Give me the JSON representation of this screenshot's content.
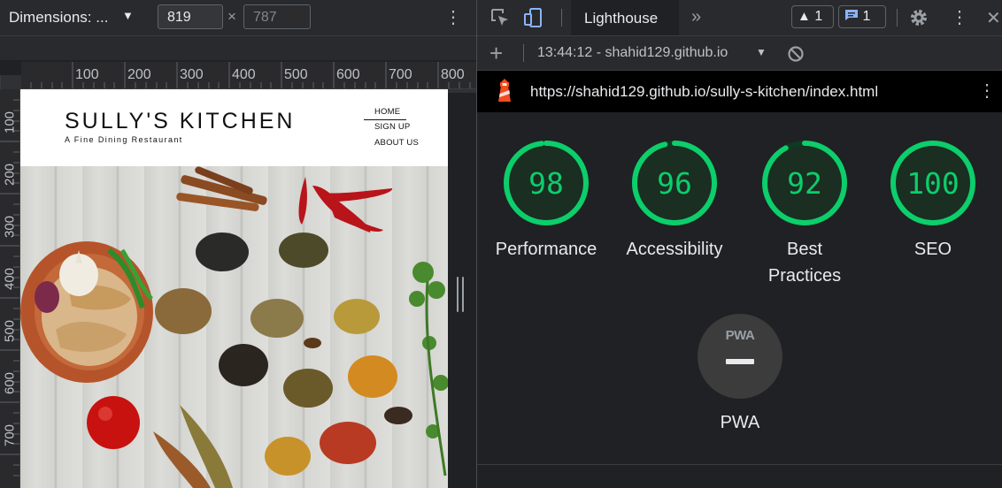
{
  "device_toolbar": {
    "dimensions_label": "Dimensions: ...",
    "caret": "▼",
    "width_value": "819",
    "times": "×",
    "height_placeholder": "787",
    "more_icon": "⋮"
  },
  "ruler": {
    "horizontal": [
      "100",
      "200",
      "300",
      "400",
      "500",
      "600",
      "700",
      "800"
    ],
    "vertical": [
      "100",
      "200",
      "300",
      "400",
      "500",
      "600",
      "700"
    ]
  },
  "site": {
    "title": "SULLY'S KITCHEN",
    "tagline": "A Fine Dining Restaurant",
    "nav": [
      "HOME",
      "SIGN UP",
      "ABOUT US"
    ]
  },
  "devtools": {
    "tab_label": "Lighthouse",
    "more_tabs": "»",
    "warnings_count": "1",
    "messages_count": "1",
    "more_icon": "⋮",
    "close_icon": "✕",
    "plus": "+",
    "report_label": "13:44:12 - shahid129.github.io",
    "report_caret": "▼",
    "url": "https://shahid129.github.io/sully-s-kitchen/index.html"
  },
  "scores": [
    {
      "value": "98",
      "label": "Performance"
    },
    {
      "value": "96",
      "label": "Accessibility"
    },
    {
      "value": "92",
      "label": "Best Practices"
    },
    {
      "value": "100",
      "label": "SEO"
    }
  ],
  "pwa": {
    "mark": "PWA",
    "label": "PWA"
  },
  "colors": {
    "pass": "#0cce6b",
    "accent_blue": "#8ab4f8",
    "lighthouse_red": "#f44b21"
  }
}
